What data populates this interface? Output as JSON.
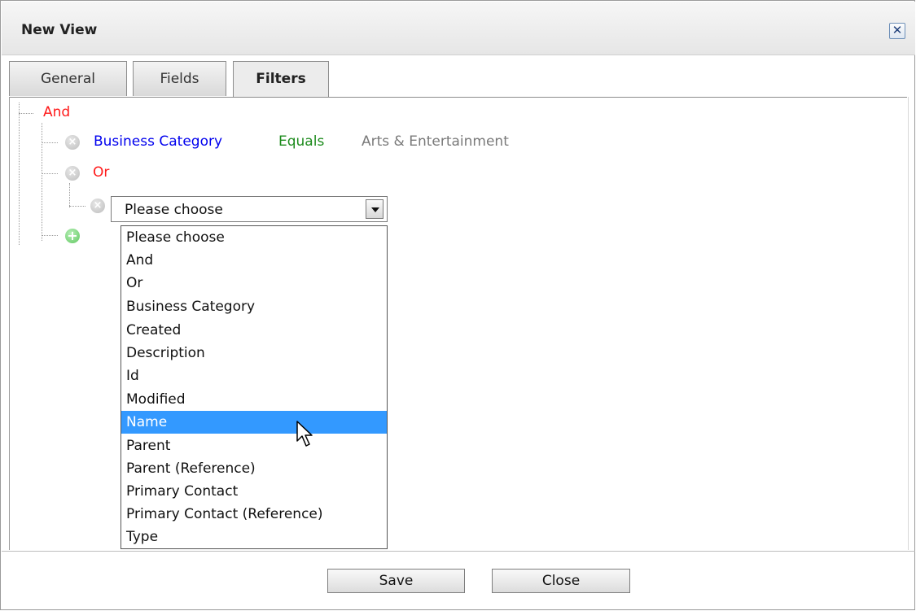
{
  "dialog": {
    "title": "New View",
    "close_icon": "close-icon"
  },
  "tabs": [
    {
      "label": "General",
      "active": false
    },
    {
      "label": "Fields",
      "active": false
    },
    {
      "label": "Filters",
      "active": true
    }
  ],
  "filter_tree": {
    "root_label": "And",
    "condition": {
      "field": "Business Category",
      "operator": "Equals",
      "value": "Arts & Entertainment"
    },
    "group_label": "Or",
    "select": {
      "value": "Please choose",
      "options": [
        "Please choose",
        "And",
        "Or",
        "Business Category",
        "Created",
        "Description",
        "Id",
        "Modified",
        "Name",
        "Parent",
        "Parent (Reference)",
        "Primary Contact",
        "Primary Contact (Reference)",
        "Type"
      ],
      "highlighted": "Name"
    },
    "remove_icon": "remove-icon",
    "add_icon": "add-icon"
  },
  "footer": {
    "save_label": "Save",
    "close_label": "Close"
  },
  "colors": {
    "logic": "#ff1a1a",
    "field": "#0000ee",
    "operator": "#1e8c1e",
    "value": "#7a7a7a",
    "highlight": "#3399ff"
  }
}
